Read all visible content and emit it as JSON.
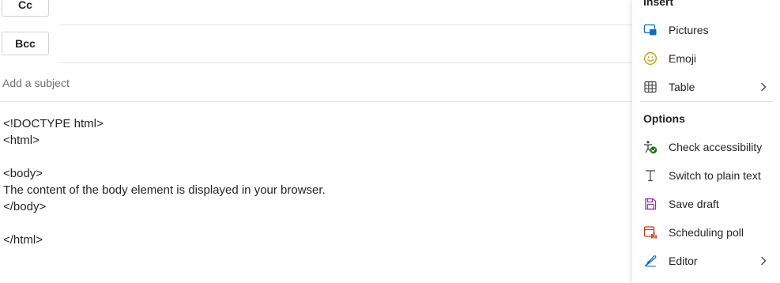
{
  "compose": {
    "cc_label": "Cc",
    "bcc_label": "Bcc",
    "subject_placeholder": "Add a subject",
    "body_lines": [
      "<!DOCTYPE html>",
      "<html>",
      "",
      "<body>",
      "The content of the body element is displayed in your browser.",
      "</body>",
      "",
      "</html>"
    ]
  },
  "panel": {
    "insert_title": "Insert",
    "options_title": "Options",
    "insert_items": [
      {
        "label": "Pictures",
        "icon": "pictures-icon"
      },
      {
        "label": "Emoji",
        "icon": "emoji-icon"
      },
      {
        "label": "Table",
        "icon": "table-icon",
        "submenu": true
      }
    ],
    "options_items": [
      {
        "label": "Check accessibility",
        "icon": "accessibility-icon"
      },
      {
        "label": "Switch to plain text",
        "icon": "plain-text-icon"
      },
      {
        "label": "Save draft",
        "icon": "save-icon"
      },
      {
        "label": "Scheduling poll",
        "icon": "scheduling-poll-icon"
      },
      {
        "label": "Editor",
        "icon": "editor-icon",
        "submenu": true
      }
    ]
  },
  "colors": {
    "accent_blue": "#0f6cbd",
    "emoji_gold": "#c19c00",
    "accessibility_green": "#107c10",
    "save_purple": "#8a3a9b",
    "poll_orange": "#c43e1c"
  }
}
